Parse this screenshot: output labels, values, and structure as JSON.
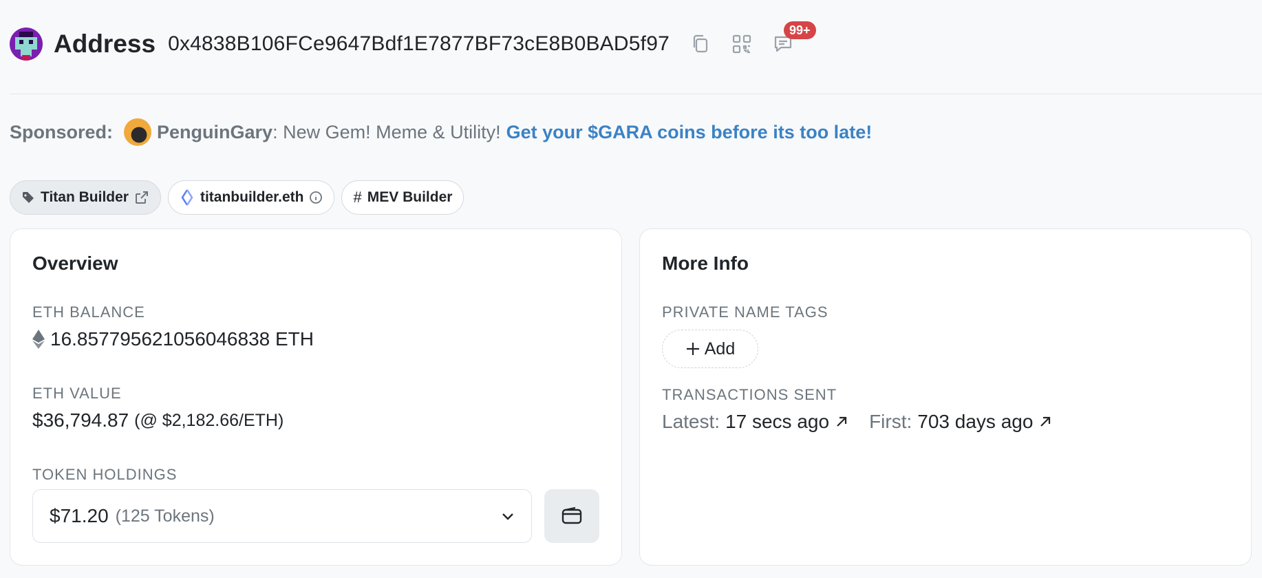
{
  "header": {
    "title": "Address",
    "address": "0x4838B106FCe9647Bdf1E7877BF73cE8B0BAD5f97",
    "comments_badge": "99+"
  },
  "sponsored": {
    "label": "Sponsored:",
    "name": "PenguinGary",
    "text": ": New Gem! Meme & Utility!",
    "link": "Get your $GARA coins before its too late!"
  },
  "tags": [
    {
      "label": "Titan Builder"
    },
    {
      "label": "titanbuilder.eth"
    },
    {
      "label": "MEV Builder"
    }
  ],
  "overview": {
    "title": "Overview",
    "eth_balance_label": "ETH BALANCE",
    "eth_balance": "16.857795621056046838 ETH",
    "eth_value_label": "ETH VALUE",
    "eth_value": "$36,794.87",
    "eth_price": "(@ $2,182.66/ETH)",
    "token_holdings_label": "TOKEN HOLDINGS",
    "token_value": "$71.20",
    "token_count": "(125 Tokens)"
  },
  "more_info": {
    "title": "More Info",
    "private_tags_label": "PRIVATE NAME TAGS",
    "add_label": "Add",
    "tx_sent_label": "TRANSACTIONS SENT",
    "latest_key": "Latest:",
    "latest_value": "17 secs ago",
    "first_key": "First:",
    "first_value": "703 days ago"
  }
}
